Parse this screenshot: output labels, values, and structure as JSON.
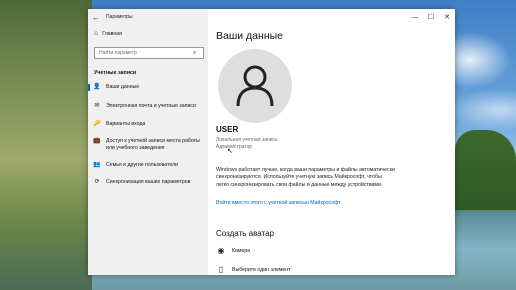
{
  "window": {
    "title": "Параметры",
    "back_glyph": "←",
    "minimize_glyph": "—",
    "maximize_glyph": "☐",
    "close_glyph": "✕"
  },
  "sidebar": {
    "home_label": "Главная",
    "home_icon": "⌂",
    "search_placeholder": "Найти параметр",
    "search_icon": "⌕",
    "section_header": "Учетные записи",
    "items": [
      {
        "label": "Ваши данные",
        "icon": "👤",
        "active": true
      },
      {
        "label": "Электронная почта и учетные записи",
        "icon": "✉",
        "active": false
      },
      {
        "label": "Варианты входа",
        "icon": "🔑",
        "active": false
      },
      {
        "label": "Доступ к учетной записи места работы или учебного заведения",
        "icon": "💼",
        "active": false
      },
      {
        "label": "Семья и другие пользователи",
        "icon": "👥",
        "active": false
      },
      {
        "label": "Синхронизация ваших параметров",
        "icon": "⟳",
        "active": false
      }
    ]
  },
  "main": {
    "title": "Ваши данные",
    "username": "USER",
    "account_type": "Локальная учетная запись",
    "account_role": "Администратор",
    "description": "Windows работает лучше, когда ваши параметры и файлы автоматически синхронизируются. Используйте учетную запись Майкрософт, чтобы легко синхронизировать свои файлы и данные между устройствами.",
    "ms_link": "Войти вместо этого с учетной записью Майкрософт",
    "create_avatar_title": "Создать аватар",
    "create_items": [
      {
        "label": "Камера",
        "icon": "◉"
      },
      {
        "label": "Выберите один элемент",
        "icon": "▯"
      }
    ]
  },
  "colors": {
    "accent": "#0067c0",
    "sidebar_bg": "#f0f0f0",
    "avatar_bg": "#dedede"
  }
}
